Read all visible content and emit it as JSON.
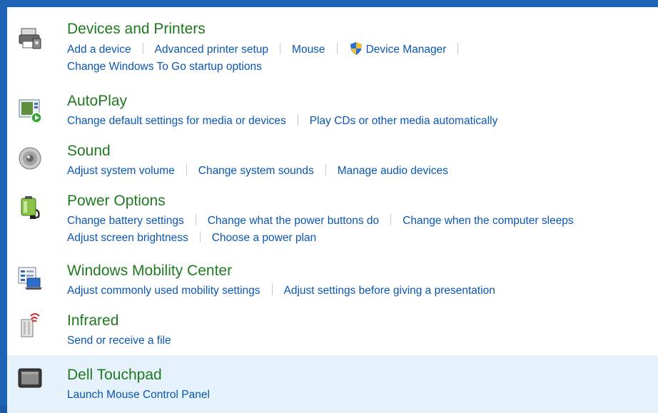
{
  "categories": [
    {
      "title": "Devices and Printers",
      "icon": "printer-icon",
      "lines": [
        [
          "Add a device",
          "Advanced printer setup",
          "Mouse",
          "Device Manager"
        ],
        [
          "Change Windows To Go startup options"
        ]
      ]
    },
    {
      "title": "AutoPlay",
      "icon": "autoplay-icon",
      "lines": [
        [
          "Change default settings for media or devices",
          "Play CDs or other media automatically"
        ]
      ]
    },
    {
      "title": "Sound",
      "icon": "speaker-icon",
      "lines": [
        [
          "Adjust system volume",
          "Change system sounds",
          "Manage audio devices"
        ]
      ]
    },
    {
      "title": "Power Options",
      "icon": "battery-icon",
      "lines": [
        [
          "Change battery settings",
          "Change what the power buttons do",
          "Change when the computer sleeps"
        ],
        [
          "Adjust screen brightness",
          "Choose a power plan"
        ]
      ]
    },
    {
      "title": "Windows Mobility Center",
      "icon": "mobility-center-icon",
      "lines": [
        [
          "Adjust commonly used mobility settings",
          "Adjust settings before giving a presentation"
        ]
      ]
    },
    {
      "title": "Infrared",
      "icon": "infrared-icon",
      "lines": [
        [
          "Send or receive a file"
        ]
      ]
    },
    {
      "title": "Dell Touchpad",
      "icon": "touchpad-icon",
      "selected": true,
      "lines": [
        [
          "Launch Mouse Control Panel"
        ]
      ]
    }
  ],
  "colors": {
    "title_green": "#1f7a1f",
    "link_blue": "#0a56b3",
    "selection": "#e5f1fb",
    "border": "#1f63b5"
  }
}
